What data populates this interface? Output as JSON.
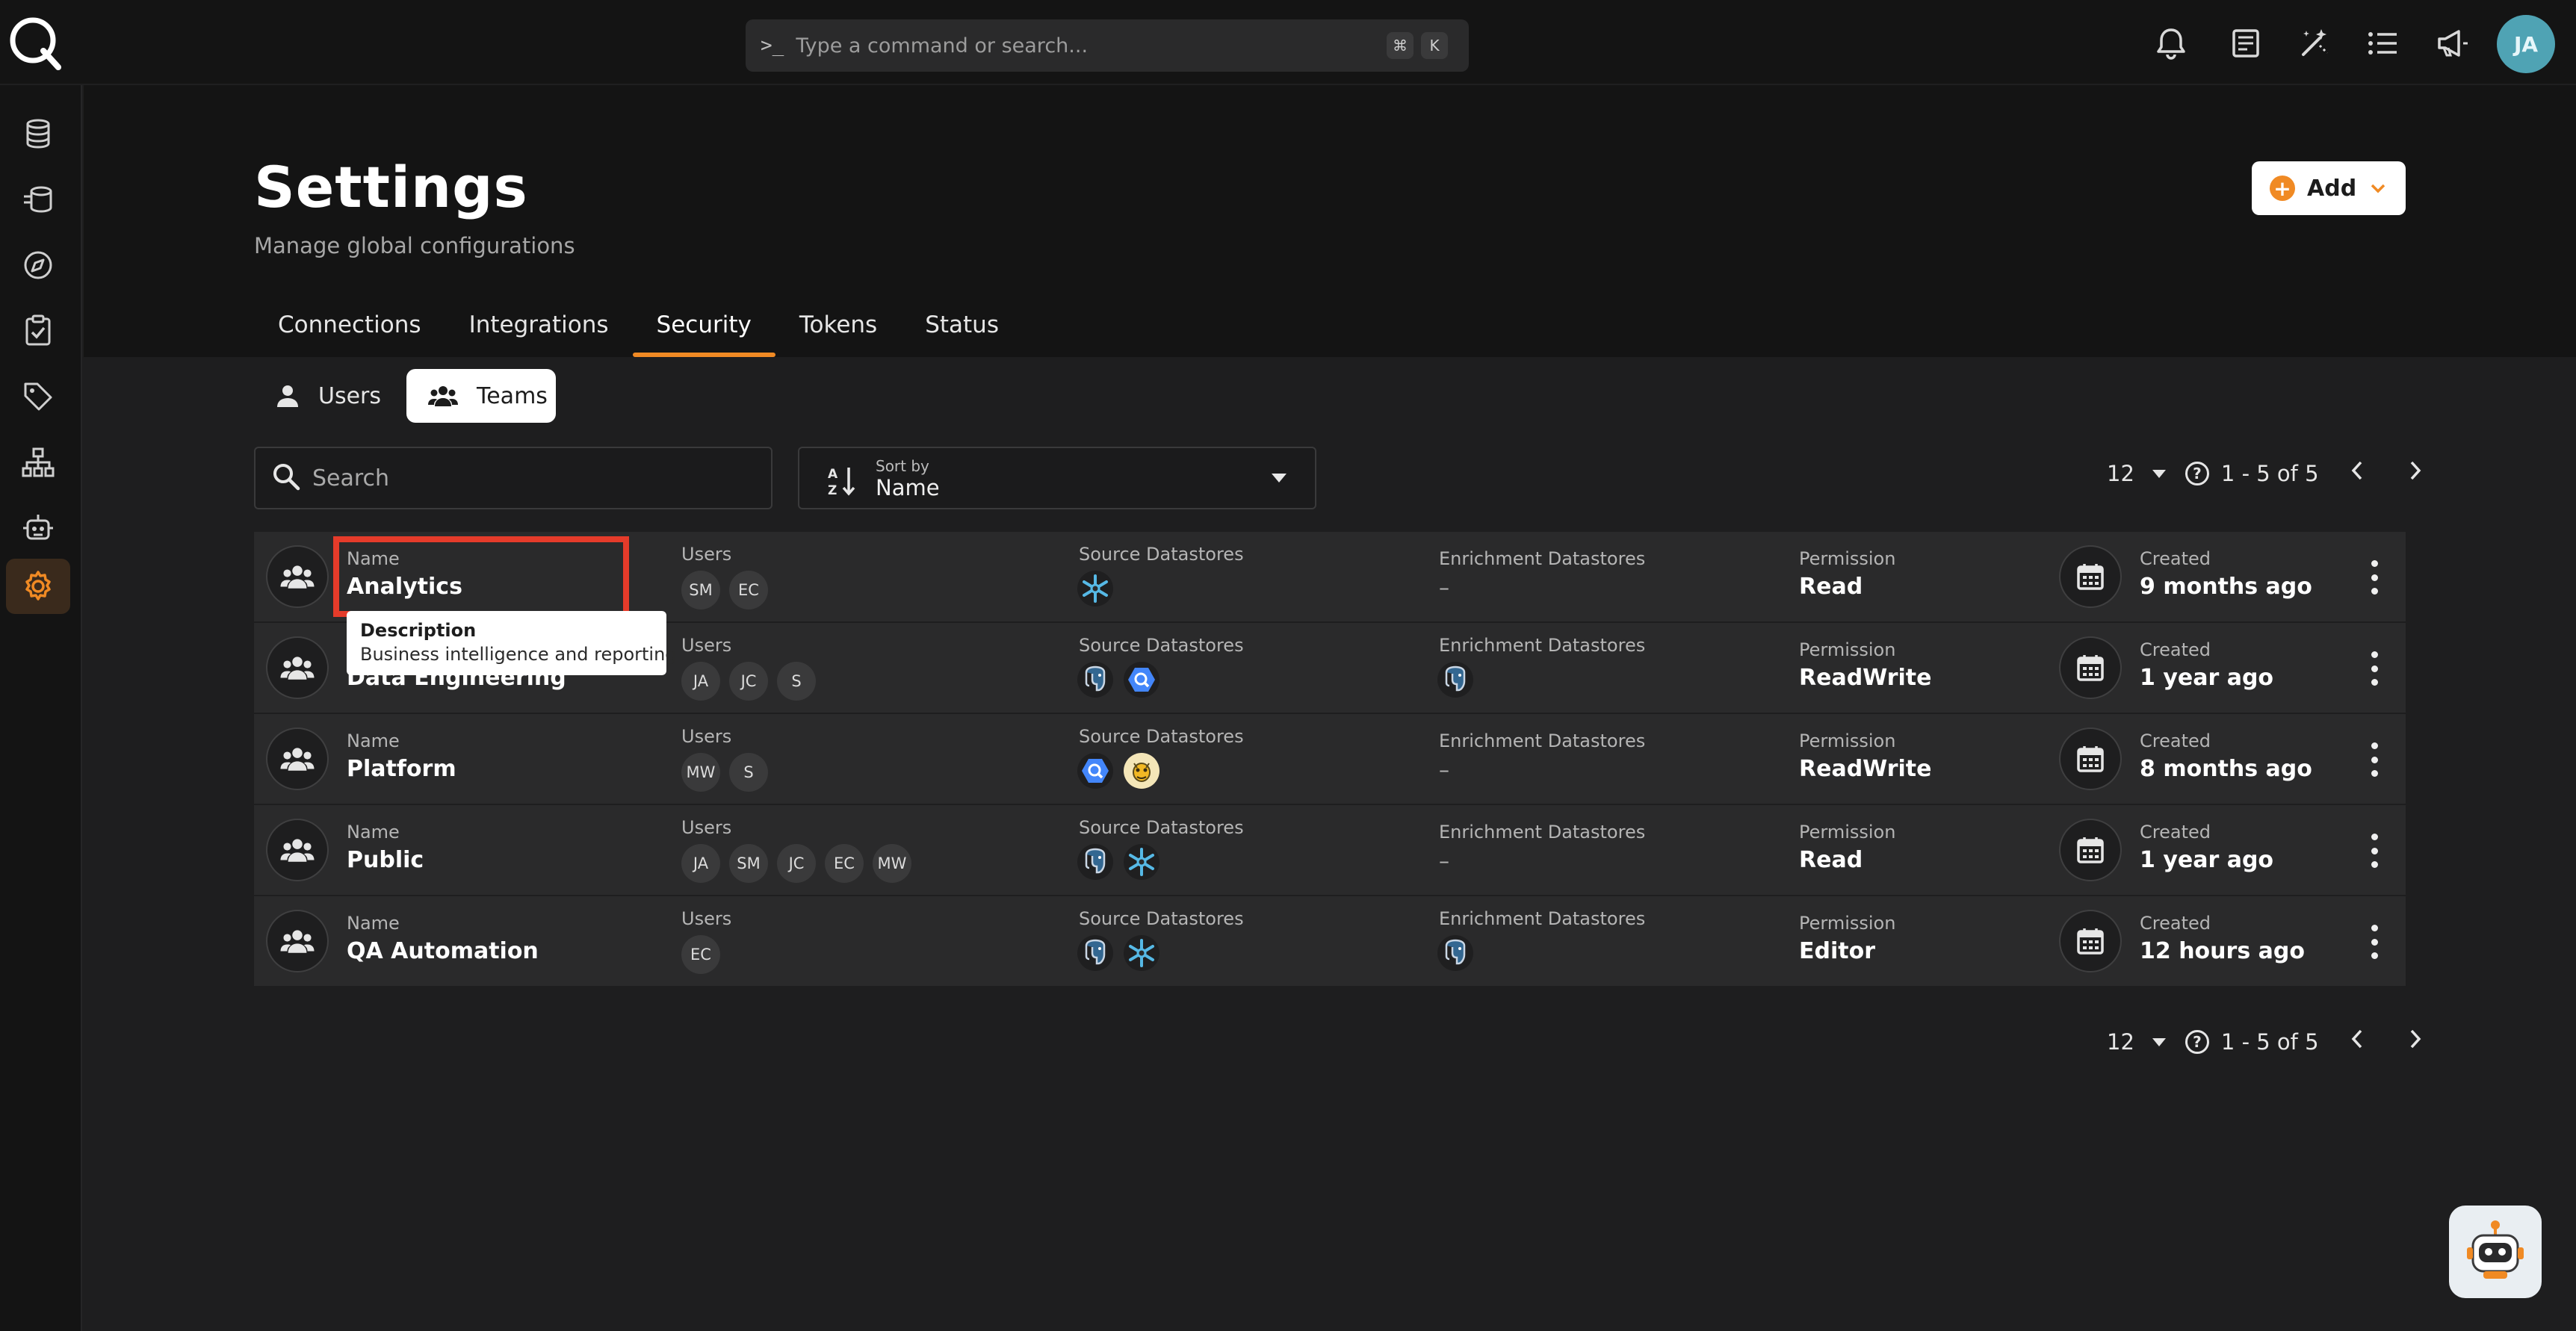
{
  "command_bar": {
    "placeholder": "Type a command or search...",
    "prompt": ">_",
    "kbd_mod": "⌘",
    "kbd_key": "K"
  },
  "user": {
    "initials": "JA"
  },
  "top_icons": [
    "bell-icon",
    "document-icon",
    "magic-wand-icon",
    "list-icon",
    "megaphone-icon"
  ],
  "sidebar": {
    "items": [
      "database-icon",
      "stacked-database-icon",
      "compass-icon",
      "clipboard-check-icon",
      "tag-icon",
      "hierarchy-icon",
      "robot-icon",
      "gear-icon"
    ],
    "active": "gear-icon"
  },
  "page": {
    "title": "Settings",
    "subtitle": "Manage global configurations"
  },
  "add_button": {
    "label": "Add"
  },
  "tabs": [
    "Connections",
    "Integrations",
    "Security",
    "Tokens",
    "Status"
  ],
  "active_tab": "Security",
  "segments": {
    "users": "Users",
    "teams": "Teams",
    "active": "Teams"
  },
  "search": {
    "placeholder": "Search"
  },
  "sort": {
    "label": "Sort by",
    "value": "Name"
  },
  "pager": {
    "page_size": "12",
    "range": "1 - 5 of 5"
  },
  "labels": {
    "name": "Name",
    "users": "Users",
    "source": "Source Datastores",
    "enrichment": "Enrichment Datastores",
    "permission": "Permission",
    "created": "Created",
    "empty": "–"
  },
  "rows": [
    {
      "name": "Analytics",
      "users": [
        "SM",
        "EC"
      ],
      "source": [
        "snowflake"
      ],
      "enrichment": [],
      "enrichment_text": "–",
      "permission": "Read",
      "created": "9 months ago"
    },
    {
      "name": "Data Engineering",
      "users": [
        "JA",
        "JC",
        "S"
      ],
      "source": [
        "postgres",
        "bigquery"
      ],
      "enrichment": [
        "postgres"
      ],
      "enrichment_text": "",
      "permission": "ReadWrite",
      "created": "1 year ago"
    },
    {
      "name": "Platform",
      "users": [
        "MW",
        "S"
      ],
      "source": [
        "bigquery",
        "hive"
      ],
      "enrichment": [],
      "enrichment_text": "–",
      "permission": "ReadWrite",
      "created": "8 months ago"
    },
    {
      "name": "Public",
      "users": [
        "JA",
        "SM",
        "JC",
        "EC",
        "MW"
      ],
      "source": [
        "postgres",
        "snowflake"
      ],
      "enrichment": [],
      "enrichment_text": "–",
      "permission": "Read",
      "created": "1 year ago"
    },
    {
      "name": "QA Automation",
      "users": [
        "EC"
      ],
      "source": [
        "postgres",
        "snowflake"
      ],
      "enrichment": [
        "postgres"
      ],
      "enrichment_text": "",
      "permission": "Editor",
      "created": "12 hours ago"
    }
  ],
  "tooltip": {
    "title": "Description",
    "text": "Business intelligence and reporting"
  },
  "colors": {
    "accent": "#f08a24",
    "highlight": "#e53b2a",
    "background": "#1e1e1f",
    "row": "#2a2a2b"
  }
}
